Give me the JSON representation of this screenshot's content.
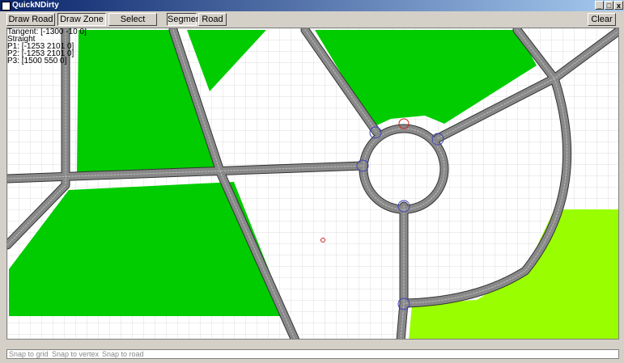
{
  "window": {
    "title": "QuickNDirty",
    "minimize_glyph": "_",
    "maximize_glyph": "□",
    "close_glyph": "x"
  },
  "toolbar": {
    "draw_road": "Draw Road",
    "draw_zone": "Draw Zone",
    "select": "Select",
    "segment": "Segment",
    "road": "Road",
    "clear": "Clear"
  },
  "info": {
    "tangent": "Tangent: [-1300 -10 0]",
    "mode": "Straight",
    "p1": "P1: [-1253 2101 0]",
    "p2": "P2: [-1253 2101 0]",
    "p3": "P3: [1500 550 0]"
  },
  "status": {
    "snap_grid": "Snap to grid",
    "snap_vertex": "Snap to vertex",
    "snap_road": "Snap to road"
  },
  "colors": {
    "zone_green": "#00cc00",
    "zone_lime": "#99ff00",
    "road": "#888888",
    "road_edge": "#333333",
    "grid": "#dcdcdc",
    "node": "#4040c0",
    "marker": "#cc2020"
  }
}
